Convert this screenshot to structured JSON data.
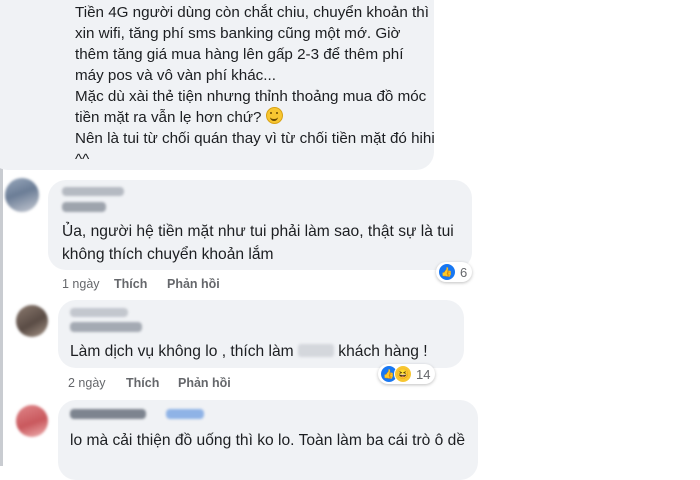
{
  "top_comment": {
    "lines": [
      "Tiền 4G người dùng còn chắt chiu, chuyển khoản thì xin wifi, tăng phí sms banking cũng một mớ. Giờ thêm tăng giá mua hàng lên gấp 2-3 để thêm phí máy pos và vô vàn phí khác...",
      "Mặc dù xài thẻ tiện nhưng thỉnh thoảng mua đồ móc tiền mặt ra vẫn lẹ hơn chứ? ",
      "Nên là tui từ chối quán thay vì từ chối tiền mặt đó hihi ^^"
    ],
    "emoji_icon": "smiling-face-emoji"
  },
  "comments": [
    {
      "text": "Ủa, người hệ tiền mặt như tui phải làm sao, thật sự là tui không thích chuyển khoản lắm",
      "time": "1 ngày",
      "like_label": "Thích",
      "reply_label": "Phản hồi",
      "reaction_count": "6",
      "reaction_icons": [
        "like-icon"
      ]
    },
    {
      "text_before": "Làm dịch vụ không lo , thích làm ",
      "text_after": " khách hàng !",
      "time": "2 ngày",
      "like_label": "Thích",
      "reply_label": "Phản hồi",
      "reaction_count": "14",
      "reaction_icons": [
        "like-icon",
        "haha-icon"
      ]
    },
    {
      "text": "lo mà cải thiện đồ uống thì ko lo. Toàn làm ba cái trò ô dề"
    }
  ],
  "colors": {
    "bubble": "#f0f2f5",
    "meta_text": "#65676b",
    "like_blue": "#1877f2"
  }
}
